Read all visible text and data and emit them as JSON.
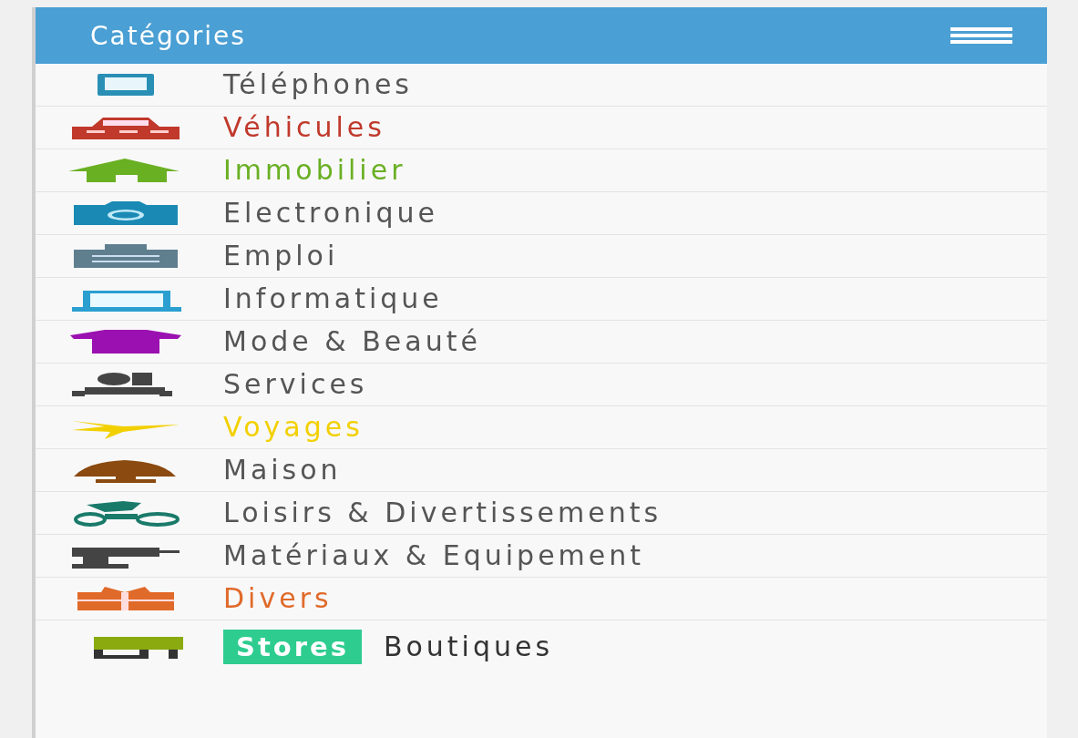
{
  "header": {
    "title": "Catégories"
  },
  "categories": [
    {
      "label": "Téléphones",
      "kind": "phone",
      "color": "#2a8fb5",
      "tinted": false
    },
    {
      "label": "Véhicules",
      "kind": "car",
      "color": "#c0392b",
      "tinted": true
    },
    {
      "label": "Immobilier",
      "kind": "house",
      "color": "#6ab023",
      "tinted": true
    },
    {
      "label": "Electronique",
      "kind": "camera",
      "color": "#1a8ab5",
      "tinted": false
    },
    {
      "label": "Emploi",
      "kind": "briefcase",
      "color": "#5f7f8f",
      "tinted": false
    },
    {
      "label": "Informatique",
      "kind": "laptop",
      "color": "#2a9fd0",
      "tinted": false
    },
    {
      "label": "Mode & Beauté",
      "kind": "shirt",
      "color": "#9b10b0",
      "tinted": false
    },
    {
      "label": "Services",
      "kind": "people",
      "color": "#444444",
      "tinted": false
    },
    {
      "label": "Voyages",
      "kind": "plane",
      "color": "#f2d000",
      "tinted": true
    },
    {
      "label": "Maison",
      "kind": "lamp",
      "color": "#8b4a10",
      "tinted": false
    },
    {
      "label": "Loisirs & Divertissements",
      "kind": "bike",
      "color": "#1a7a6a",
      "tinted": false
    },
    {
      "label": "Matériaux & Equipement",
      "kind": "drill",
      "color": "#444444",
      "tinted": false
    },
    {
      "label": "Divers",
      "kind": "gift",
      "color": "#e06a2a",
      "tinted": true
    }
  ],
  "stores": {
    "kind": "sofa",
    "color": "#8aaa10",
    "tag": "Stores",
    "label": "Boutiques"
  }
}
